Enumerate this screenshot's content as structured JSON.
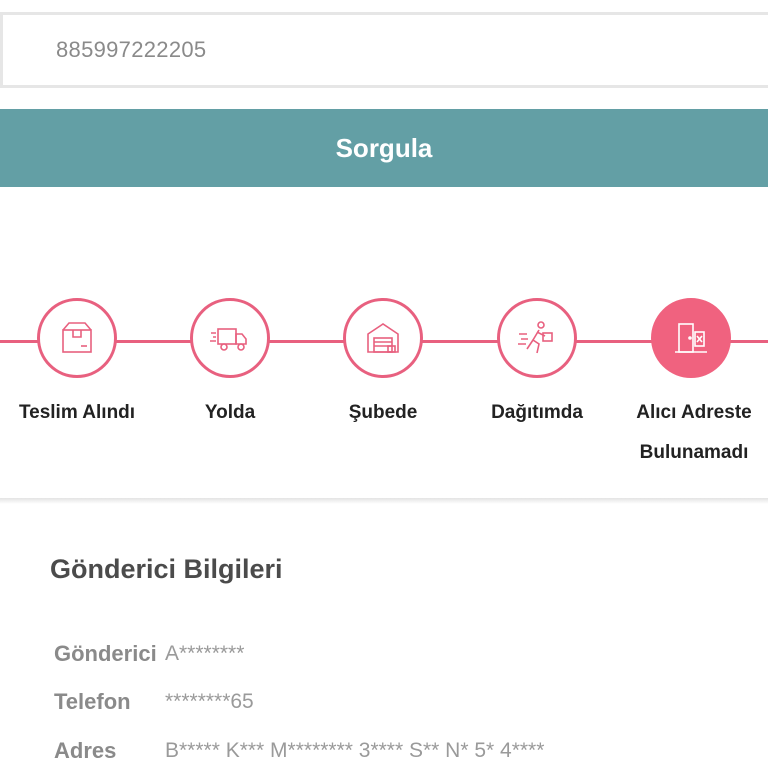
{
  "search": {
    "value": "885997222205"
  },
  "query_button": {
    "label": "Sorgula"
  },
  "colors": {
    "accent": "#639fa5",
    "timeline": "#e8607f",
    "active_step": "#f0627f"
  },
  "timeline": {
    "steps": [
      {
        "label": "Teslim Alındı",
        "icon": "package-icon",
        "active": false
      },
      {
        "label": "Yolda",
        "icon": "delivery-truck-icon",
        "active": false
      },
      {
        "label": "Şubede",
        "icon": "warehouse-icon",
        "active": false
      },
      {
        "label": "Dağıtımda",
        "icon": "courier-running-icon",
        "active": false
      },
      {
        "label": "Alıcı Adreste Bulunamadı",
        "label_line1": "Alıcı Adreste",
        "label_line2": "Bulunamadı",
        "icon": "door-not-found-icon",
        "active": true
      }
    ]
  },
  "sender": {
    "title": "Gönderici Bilgileri",
    "rows": [
      {
        "key": "Gönderici",
        "value": "A********"
      },
      {
        "key": "Telefon",
        "value": "********65"
      },
      {
        "key": "Adres",
        "value": "B***** K*** M******** 3**** S** N* 5* 4****"
      }
    ]
  }
}
